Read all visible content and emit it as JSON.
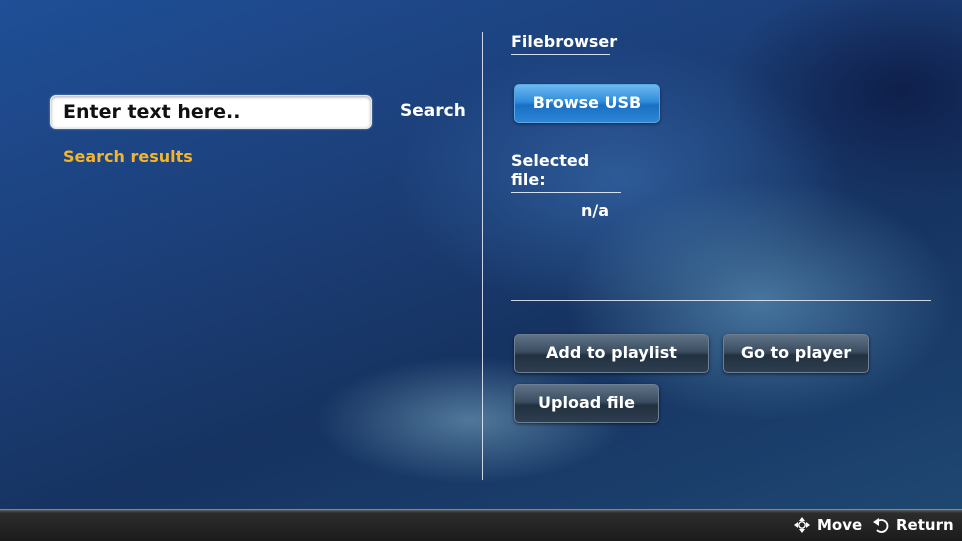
{
  "search": {
    "placeholder": "Enter text here..",
    "button_label": "Search",
    "results_label": "Search results"
  },
  "filebrowser": {
    "heading": "Filebrowser",
    "browse_label": "Browse USB",
    "selected_heading": "Selected file:",
    "selected_value": "n/a"
  },
  "actions": {
    "add_to_playlist": "Add to playlist",
    "go_to_player": "Go to player",
    "upload_file": "Upload file"
  },
  "footer": {
    "move_label": "Move",
    "move_icon": "move-arrows-icon",
    "return_label": "Return",
    "return_icon": "return-icon"
  },
  "colors": {
    "accent_results": "#f3b52b",
    "browse_button": "#2f8ddb",
    "background": "#1c3f79"
  }
}
